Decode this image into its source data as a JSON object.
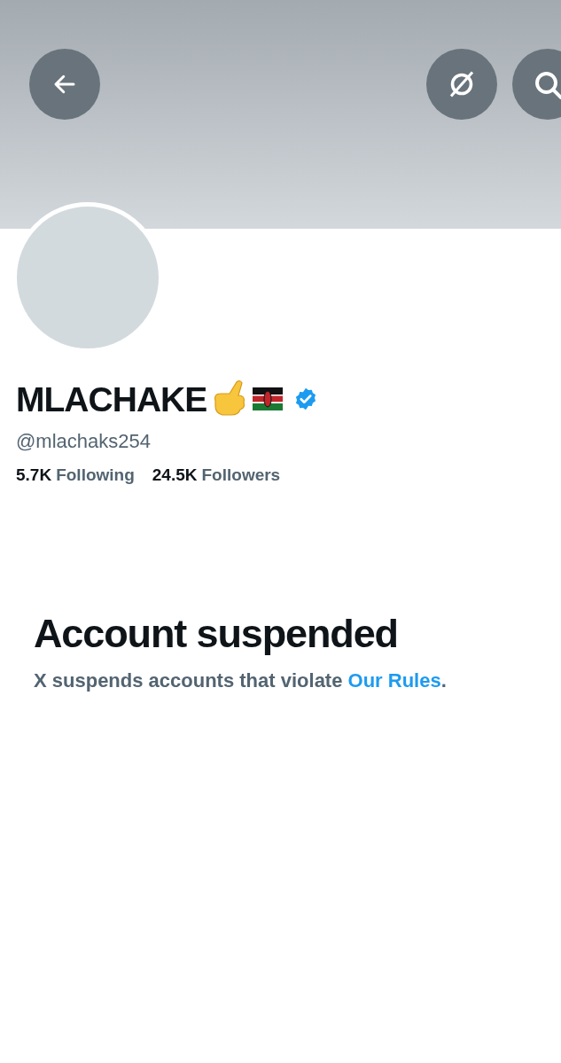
{
  "profile": {
    "name": "MLACHAKE",
    "verified": true,
    "handle": "@mlachaks254",
    "stats": [
      {
        "count": "5.7K",
        "label": "Following"
      },
      {
        "count": "24.5K",
        "label": "Followers"
      }
    ]
  },
  "notice": {
    "title": "Account suspended",
    "text": "X suspends accounts that violate ",
    "link": "Our Rules",
    "end": "."
  }
}
